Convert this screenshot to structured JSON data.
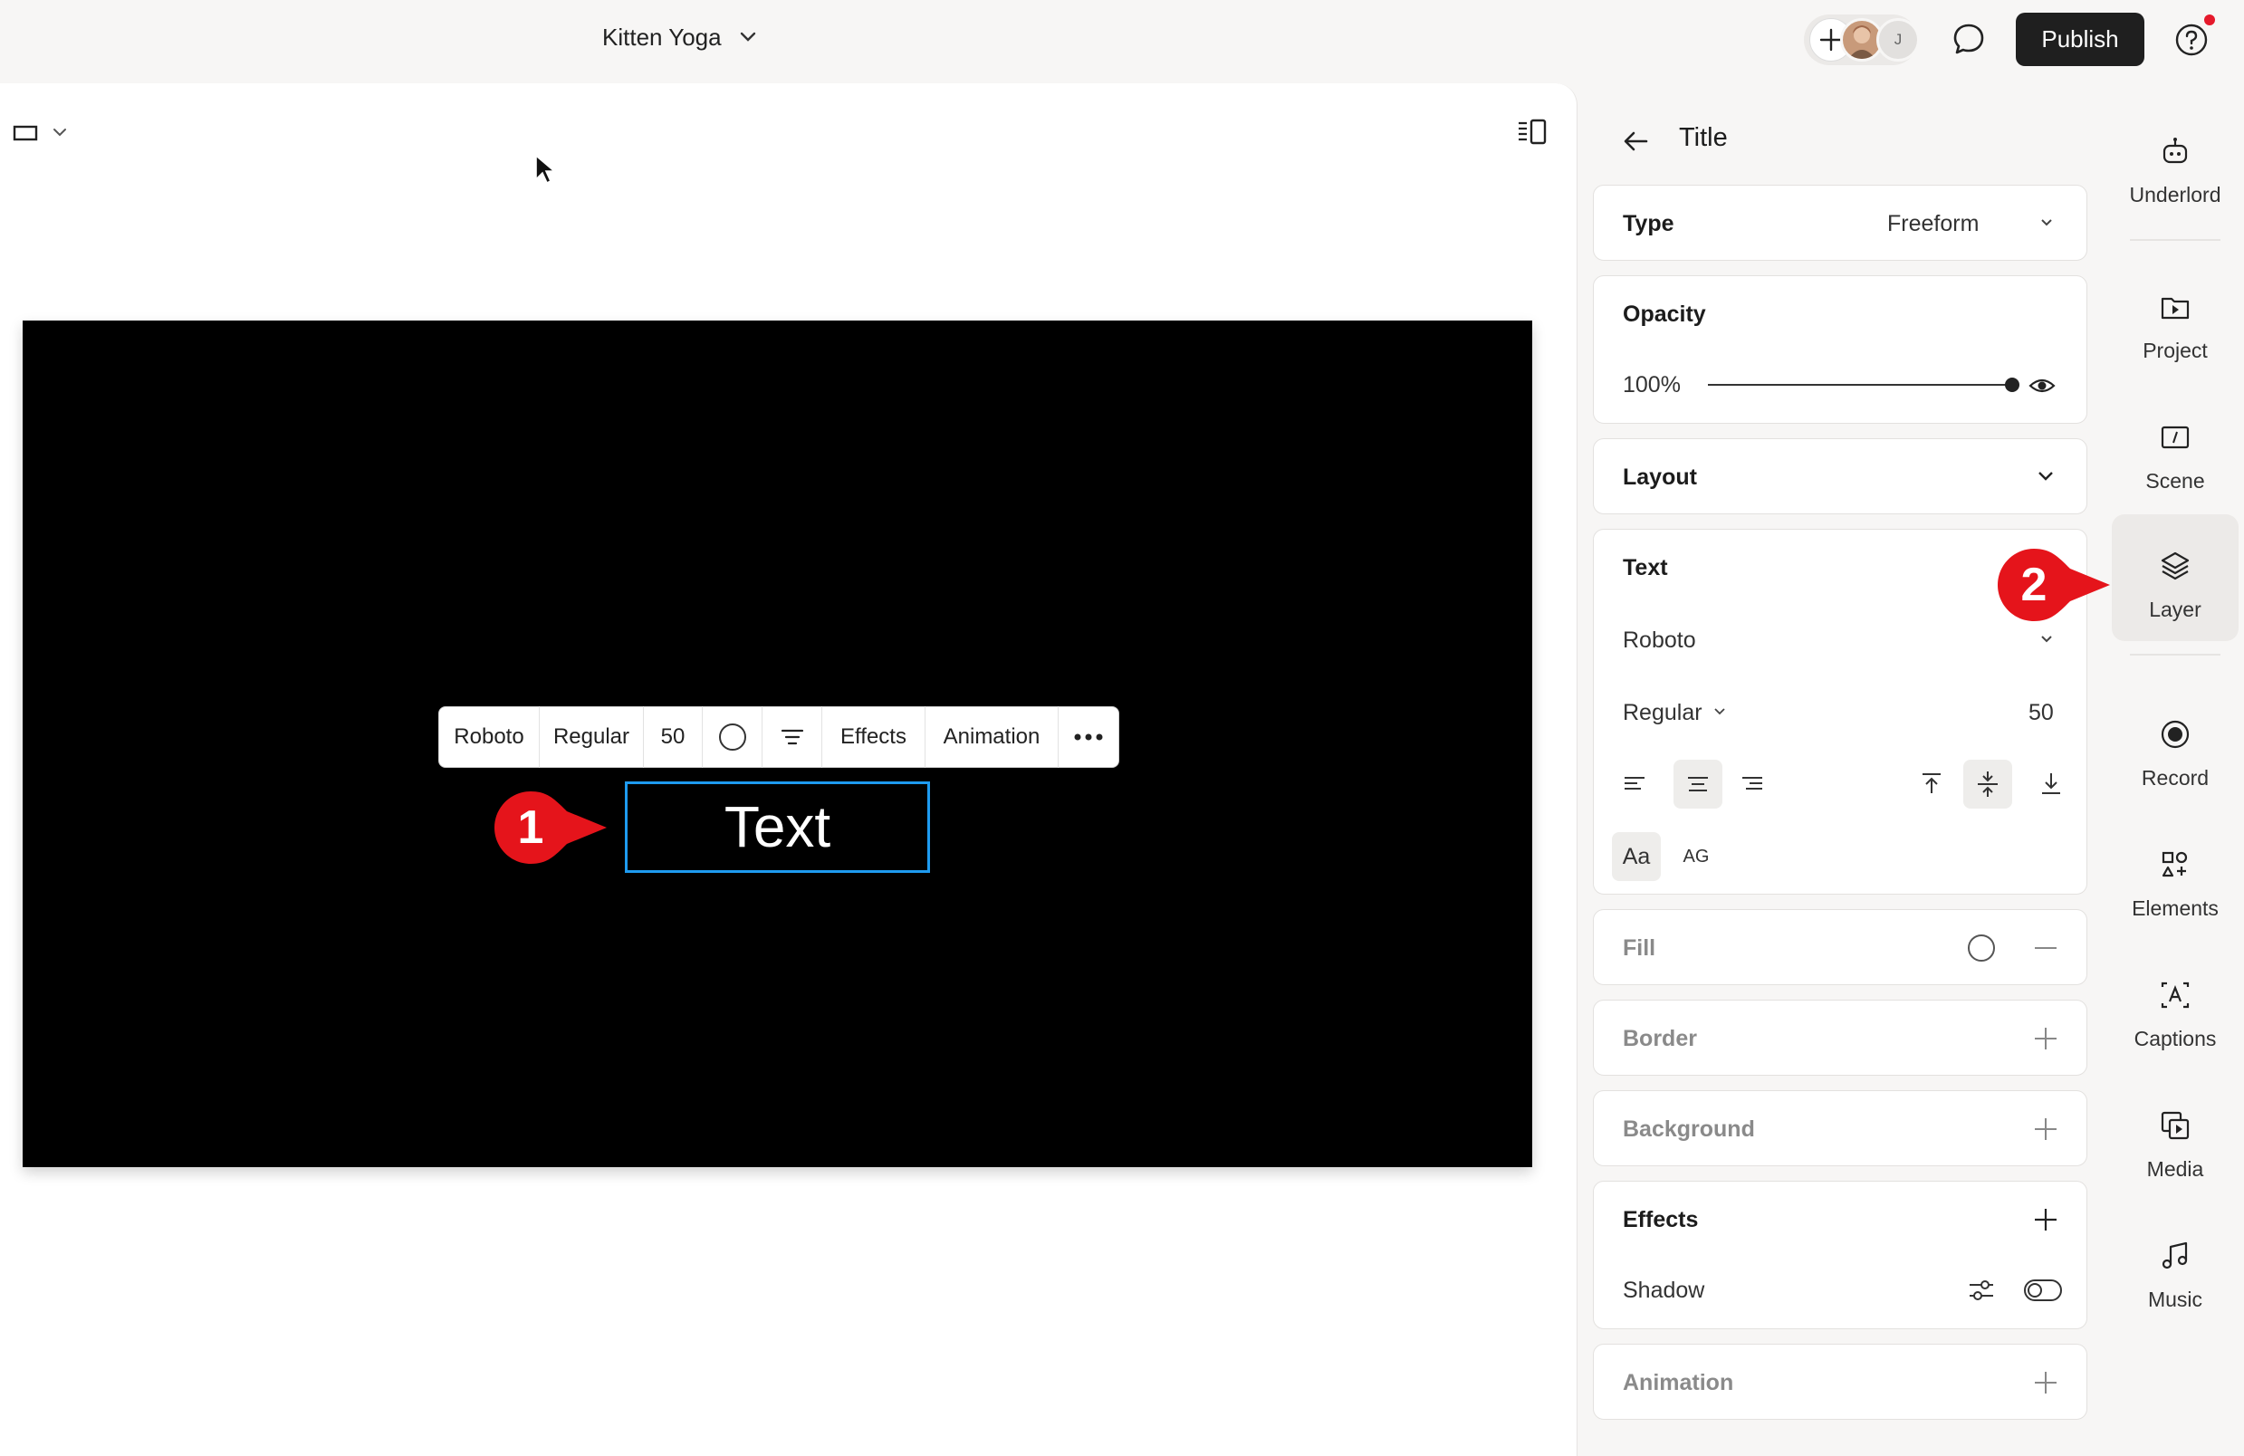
{
  "header": {
    "project_title": "Kitten Yoga",
    "collaborator_initial": "J",
    "publish_label": "Publish"
  },
  "canvas": {
    "selected_text": "Text",
    "toolbar": {
      "font": "Roboto",
      "weight": "Regular",
      "size": "50",
      "effects_label": "Effects",
      "animation_label": "Animation"
    },
    "callouts": [
      "1",
      "2"
    ]
  },
  "panel": {
    "title": "Title",
    "type": {
      "label": "Type",
      "value": "Freeform"
    },
    "opacity": {
      "label": "Opacity",
      "value": "100%",
      "level": 1.0
    },
    "layout_label": "Layout",
    "text": {
      "label": "Text",
      "font": "Roboto",
      "weight": "Regular",
      "size": "50",
      "case_mixed": "Aa",
      "case_upper": "AG"
    },
    "fill_label": "Fill",
    "border_label": "Border",
    "background_label": "Background",
    "effects": {
      "label": "Effects",
      "shadow_label": "Shadow"
    },
    "animation_label": "Animation"
  },
  "sidebar": {
    "items": [
      {
        "label": "Underlord",
        "icon": "robot-icon"
      },
      {
        "label": "Project",
        "icon": "folder-play-icon"
      },
      {
        "label": "Scene",
        "icon": "scene-icon"
      },
      {
        "label": "Layer",
        "icon": "layers-icon"
      },
      {
        "label": "Record",
        "icon": "record-icon"
      },
      {
        "label": "Elements",
        "icon": "elements-icon"
      },
      {
        "label": "Captions",
        "icon": "captions-icon"
      },
      {
        "label": "Media",
        "icon": "media-icon"
      },
      {
        "label": "Music",
        "icon": "music-icon"
      }
    ],
    "active": "Layer"
  },
  "colors": {
    "accent_selection": "#1e9bf0",
    "callout_red": "#e5141b",
    "publish_bg": "#1f1f1f",
    "notification": "#e5192b"
  }
}
